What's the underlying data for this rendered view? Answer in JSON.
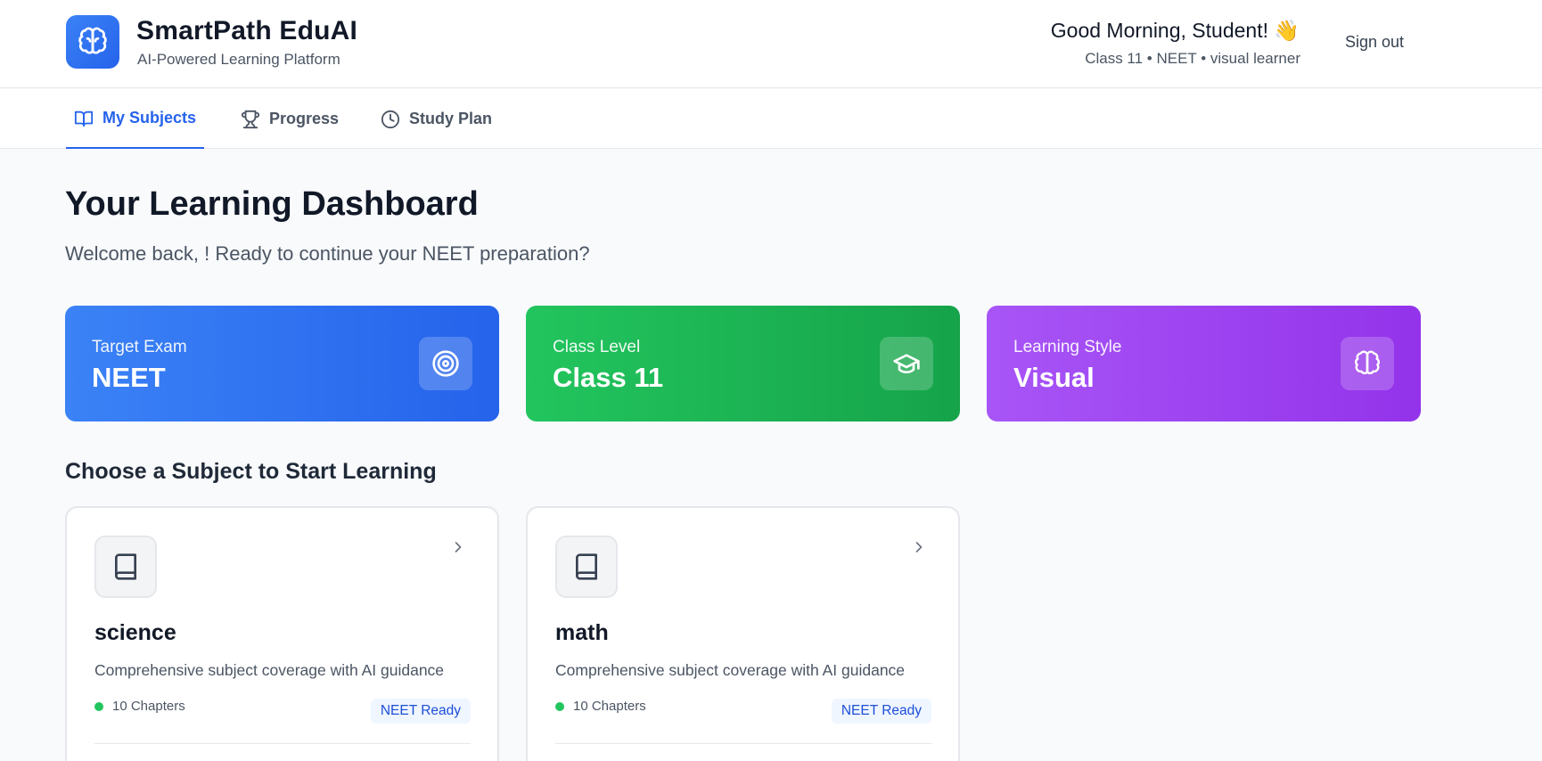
{
  "header": {
    "app_title": "SmartPath EduAI",
    "app_subtitle": "AI-Powered Learning Platform",
    "greeting": "Good Morning, Student! 👋",
    "user_meta": "Class 11 • NEET • visual learner",
    "signout_label": "Sign out",
    "logo_icon": "brain-icon"
  },
  "nav": {
    "tabs": [
      {
        "label": "My Subjects",
        "icon": "book-open-icon",
        "active": true
      },
      {
        "label": "Progress",
        "icon": "trophy-icon",
        "active": false
      },
      {
        "label": "Study Plan",
        "icon": "clock-icon",
        "active": false
      }
    ]
  },
  "main": {
    "title": "Your Learning Dashboard",
    "subtitle": "Welcome back, ! Ready to continue your NEET preparation?",
    "stats": [
      {
        "label": "Target Exam",
        "value": "NEET",
        "icon": "target-icon",
        "color": "#3b82f6"
      },
      {
        "label": "Class Level",
        "value": "Class 11",
        "icon": "graduation-cap-icon",
        "color": "#22c55e"
      },
      {
        "label": "Learning Style",
        "value": "Visual",
        "icon": "brain-icon",
        "color": "#a855f7"
      }
    ],
    "section_title": "Choose a Subject to Start Learning",
    "subjects": [
      {
        "name": "science",
        "description": "Comprehensive subject coverage with AI guidance",
        "chapters": "10 Chapters",
        "badge": "NEET Ready",
        "icon": "book-icon"
      },
      {
        "name": "math",
        "description": "Comprehensive subject coverage with AI guidance",
        "chapters": "10 Chapters",
        "badge": "NEET Ready",
        "icon": "book-icon"
      }
    ]
  },
  "colors": {
    "accent": "#2563eb",
    "success": "#22c55e",
    "purple": "#a855f7"
  }
}
